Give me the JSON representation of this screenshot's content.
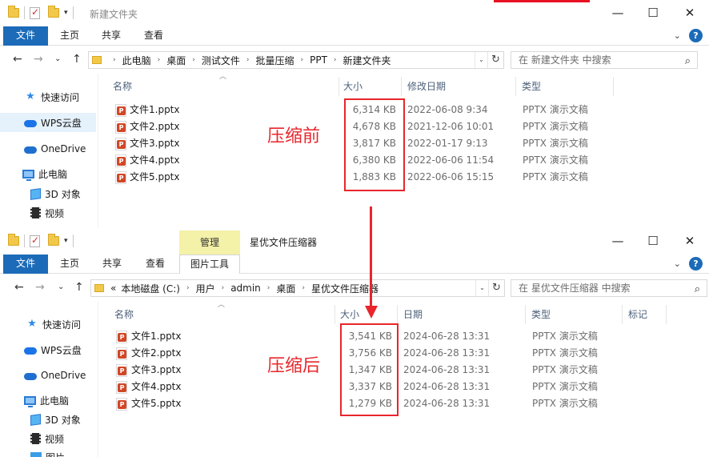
{
  "window1": {
    "title": "新建文件夹",
    "ribbon_tabs": [
      "文件",
      "主页",
      "共享",
      "查看"
    ],
    "breadcrumb": [
      "此电脑",
      "桌面",
      "测试文件",
      "批量压缩",
      "PPT",
      "新建文件夹"
    ],
    "search_placeholder": "在 新建文件夹 中搜索",
    "sidebar": [
      "快速访问",
      "WPS云盘",
      "OneDrive",
      "此电脑",
      "3D 对象",
      "视频"
    ],
    "columns": [
      "名称",
      "大小",
      "修改日期",
      "类型"
    ],
    "files": [
      {
        "name": "文件1.pptx",
        "size": "6,314 KB",
        "date": "2022-06-08 9:34",
        "type": "PPTX 演示文稿"
      },
      {
        "name": "文件2.pptx",
        "size": "4,678 KB",
        "date": "2021-12-06 10:01",
        "type": "PPTX 演示文稿"
      },
      {
        "name": "文件3.pptx",
        "size": "3,817 KB",
        "date": "2022-01-17 9:13",
        "type": "PPTX 演示文稿"
      },
      {
        "name": "文件4.pptx",
        "size": "6,380 KB",
        "date": "2022-06-06 11:54",
        "type": "PPTX 演示文稿"
      },
      {
        "name": "文件5.pptx",
        "size": "1,883 KB",
        "date": "2022-06-06 15:15",
        "type": "PPTX 演示文稿"
      }
    ],
    "annotation": "压缩前"
  },
  "window2": {
    "title": "星优文件压缩器",
    "context_tab": "管理",
    "ribbon_tabs": [
      "文件",
      "主页",
      "共享",
      "查看",
      "图片工具"
    ],
    "breadcrumb_prefix": "«",
    "breadcrumb": [
      "本地磁盘 (C:)",
      "用户",
      "admin",
      "桌面",
      "星优文件压缩器"
    ],
    "search_placeholder": "在 星优文件压缩器 中搜索",
    "sidebar": [
      "快速访问",
      "WPS云盘",
      "OneDrive",
      "此电脑",
      "3D 对象",
      "视频",
      "图片"
    ],
    "columns": [
      "名称",
      "大小",
      "日期",
      "类型",
      "标记"
    ],
    "files": [
      {
        "name": "文件1.pptx",
        "size": "3,541 KB",
        "date": "2024-06-28 13:31",
        "type": "PPTX 演示文稿"
      },
      {
        "name": "文件2.pptx",
        "size": "3,756 KB",
        "date": "2024-06-28 13:31",
        "type": "PPTX 演示文稿"
      },
      {
        "name": "文件3.pptx",
        "size": "1,347 KB",
        "date": "2024-06-28 13:31",
        "type": "PPTX 演示文稿"
      },
      {
        "name": "文件4.pptx",
        "size": "3,337 KB",
        "date": "2024-06-28 13:31",
        "type": "PPTX 演示文稿"
      },
      {
        "name": "文件5.pptx",
        "size": "1,279 KB",
        "date": "2024-06-28 13:31",
        "type": "PPTX 演示文稿"
      }
    ],
    "annotation": "压缩后"
  },
  "icons": {
    "window_minimize": "—",
    "window_maximize": "☐",
    "window_close": "✕",
    "nav_back": "←",
    "nav_forward": "→",
    "nav_recent": "⌄",
    "nav_up": "↑",
    "refresh": "↻",
    "search": "⌕",
    "ribbon_expand": "⌄",
    "help": "?",
    "dropdown": "⌄",
    "breadcrumb_separator": "›"
  },
  "colors": {
    "accent": "#1c6bb8",
    "annotation_red": "#e8262b",
    "context_tab": "#f4f1a8"
  }
}
